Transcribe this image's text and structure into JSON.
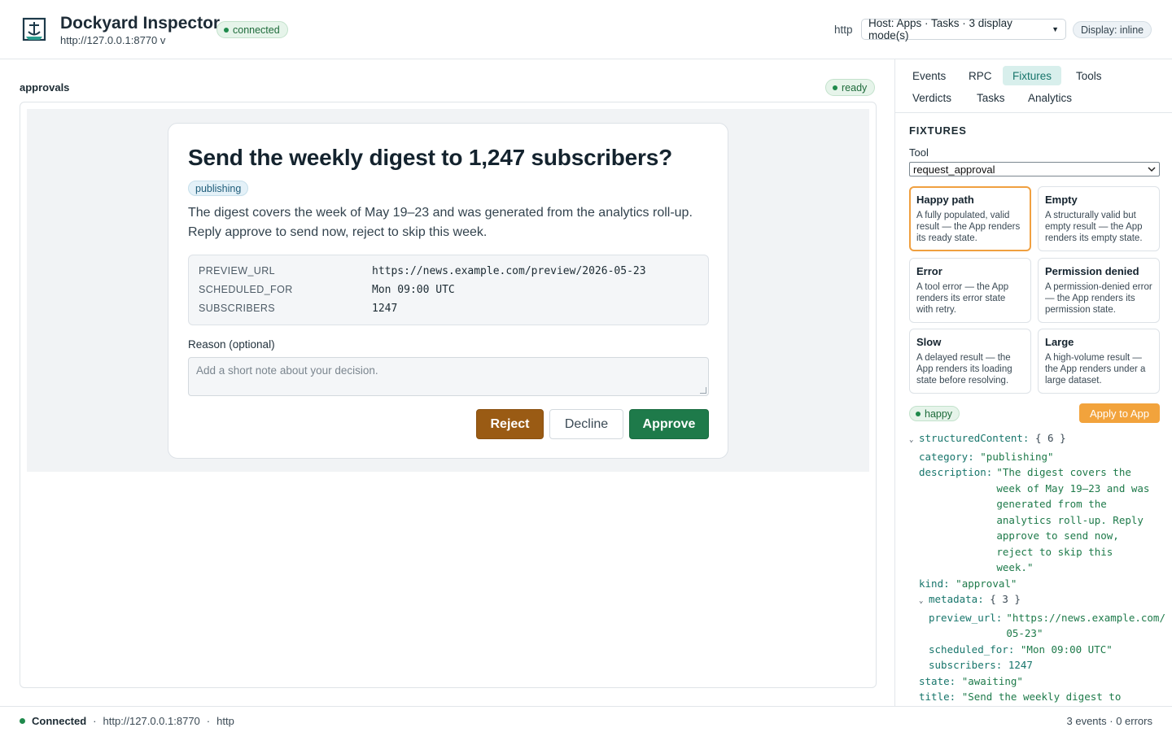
{
  "header": {
    "app_title": "Dockyard Inspector",
    "server_url": "http://127.0.0.1:8770 v",
    "status": "connected",
    "transport": "http",
    "host_mode": "Host: Apps · Tasks · 3 display mode(s)",
    "display": "Display: inline"
  },
  "main": {
    "frame_label": "approvals",
    "frame_status": "ready",
    "card": {
      "title": "Send the weekly digest to 1,247 subscribers?",
      "category": "publishing",
      "description": "The digest covers the week of May 19–23 and was generated from the analytics roll-up. Reply approve to send now, reject to skip this week.",
      "metadata": [
        {
          "key": "PREVIEW_URL",
          "value": "https://news.example.com/preview/2026-05-23"
        },
        {
          "key": "SCHEDULED_FOR",
          "value": "Mon 09:00 UTC"
        },
        {
          "key": "SUBSCRIBERS",
          "value": "1247"
        }
      ],
      "reason_label": "Reason (optional)",
      "reason_placeholder": "Add a short note about your decision.",
      "reject_label": "Reject",
      "decline_label": "Decline",
      "approve_label": "Approve"
    }
  },
  "sidebar": {
    "tabs": [
      "Events",
      "RPC",
      "Fixtures",
      "Tools",
      "Verdicts",
      "Tasks",
      "Analytics"
    ],
    "active_tab": "Fixtures",
    "section_title": "FIXTURES",
    "tool_label": "Tool",
    "tool_value": "request_approval",
    "fixtures": [
      {
        "name": "Happy path",
        "desc": "A fully populated, valid result — the App renders its ready state.",
        "selected": true
      },
      {
        "name": "Empty",
        "desc": "A structurally valid but empty result — the App renders its empty state."
      },
      {
        "name": "Error",
        "desc": "A tool error — the App renders its error state with retry."
      },
      {
        "name": "Permission denied",
        "desc": "A permission-denied error — the App renders its permission state."
      },
      {
        "name": "Slow",
        "desc": "A delayed result — the App renders its loading state before resolving."
      },
      {
        "name": "Large",
        "desc": "A high-volume result — the App renders under a large dataset."
      }
    ],
    "selected_fixture": "happy",
    "apply_label": "Apply to App",
    "json_preview": {
      "root_key": "structuredContent:",
      "root_count": "{ 6 }",
      "category_key": "category:",
      "category_val": "\"publishing\"",
      "description_key": "description:",
      "description_lines": [
        "\"The digest covers the",
        "week of May 19–23 and was",
        "generated from the",
        "analytics roll-up. Reply",
        "approve to send now,",
        "reject to skip this",
        "week.\""
      ],
      "kind_key": "kind:",
      "kind_val": "\"approval\"",
      "metadata_key": "metadata:",
      "metadata_count": "{ 3 }",
      "preview_url_key": "preview_url:",
      "preview_url_lines": [
        "\"https://news.example.com/",
        "05-23\""
      ],
      "scheduled_for_key": "scheduled_for:",
      "scheduled_for_val": "\"Mon 09:00 UTC\"",
      "subscribers_key": "subscribers:",
      "subscribers_val": "1247",
      "state_key": "state:",
      "state_val": "\"awaiting\"",
      "title_key": "title:",
      "title_val": "\"Send the weekly digest to"
    }
  },
  "footer": {
    "status": "Connected",
    "url": "http://127.0.0.1:8770",
    "transport": "http",
    "separator": "·",
    "summary": "3 events · 0 errors"
  },
  "colors": {
    "accent_teal": "#17756b",
    "approve_green": "#1e7a4a",
    "reject_brown": "#9a5b14",
    "apply_orange": "#f2a33c",
    "status_green": "#1f8a4c"
  },
  "icons": {
    "logo": "dockyard-logo-icon",
    "status_dot": "status-dot-icon",
    "caret": "chevron-down-icon"
  }
}
